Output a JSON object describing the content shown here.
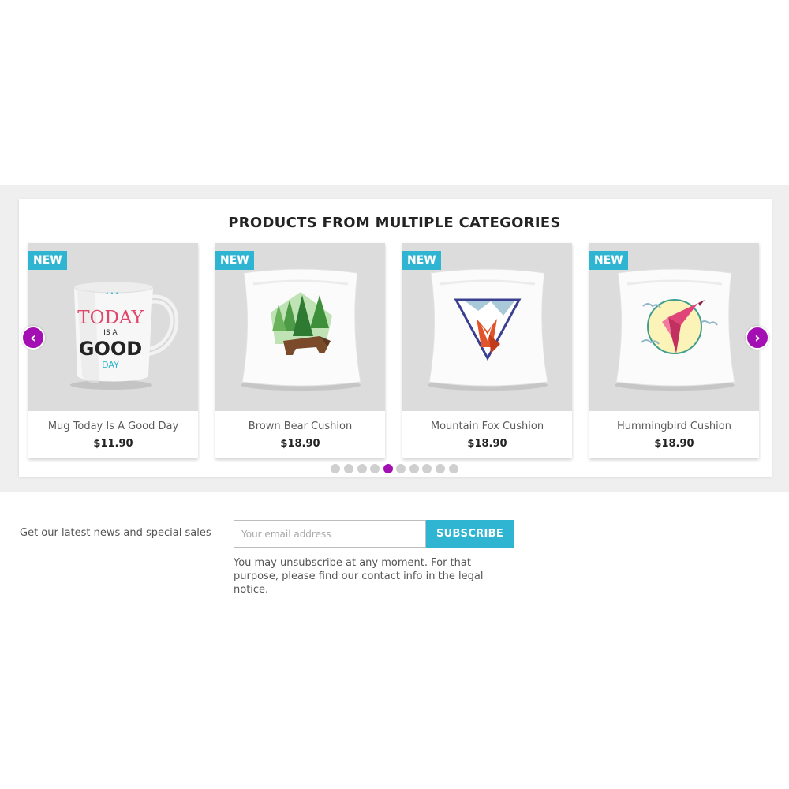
{
  "section": {
    "title": "PRODUCTS FROM MULTIPLE CATEGORIES"
  },
  "products": [
    {
      "badge": "NEW",
      "name": "Mug Today Is A Good Day",
      "price": "$11.90"
    },
    {
      "badge": "NEW",
      "name": "Brown Bear Cushion",
      "price": "$18.90"
    },
    {
      "badge": "NEW",
      "name": "Mountain Fox Cushion",
      "price": "$18.90"
    },
    {
      "badge": "NEW",
      "name": "Hummingbird Cushion",
      "price": "$18.90"
    }
  ],
  "mug_text": {
    "line1": "TODAY",
    "line2": "IS A",
    "line3": "GOOD",
    "line4": "DAY"
  },
  "carousel": {
    "prev_icon": "chevron-left-icon",
    "next_icon": "chevron-right-icon",
    "dot_count": 10,
    "active_dot": 5
  },
  "newsletter": {
    "label": "Get our latest news and special sales",
    "placeholder": "Your email address",
    "button": "SUBSCRIBE",
    "note": "You may unsubscribe at any moment. For that purpose, please find our contact info in the legal notice."
  },
  "colors": {
    "accent": "#2fb5d2",
    "carousel": "#a30fb3",
    "band": "#efefef"
  }
}
